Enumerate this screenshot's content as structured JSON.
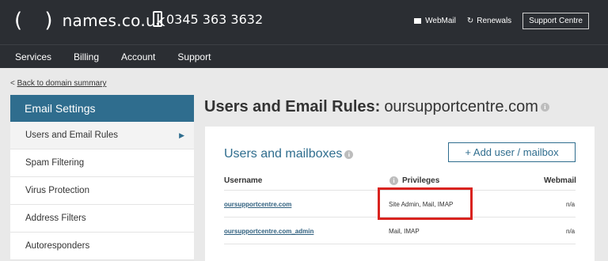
{
  "header": {
    "logo_brackets": "( )",
    "logo_text": "names.co.uk",
    "phone": "0345 363 3632",
    "webmail": "WebMail",
    "renewals": "Renewals",
    "support_centre": "Support Centre"
  },
  "nav": [
    "Services",
    "Billing",
    "Account",
    "Support"
  ],
  "breadcrumb": {
    "prefix": "<",
    "back_link": "Back to domain summary"
  },
  "sidebar": {
    "heading": "Email Settings",
    "items": [
      {
        "label": "Users and Email Rules",
        "active": true
      },
      {
        "label": "Spam Filtering"
      },
      {
        "label": "Virus Protection"
      },
      {
        "label": "Address Filters"
      },
      {
        "label": "Autoresponders"
      }
    ]
  },
  "page": {
    "title_bold": "Users and Email Rules:",
    "title_domain": "oursupportcentre.com"
  },
  "panel": {
    "title": "Users and mailboxes",
    "add_button": "+ Add user / mailbox",
    "columns": {
      "username": "Username",
      "privileges": "Privileges",
      "webmail": "Webmail"
    },
    "rows": [
      {
        "username": "oursupportcentre.com",
        "privileges": "Site Admin, Mail, IMAP",
        "webmail": "n/a"
      },
      {
        "username": "oursupportcentre.com_admin",
        "privileges": "Mail, IMAP",
        "webmail": "n/a"
      }
    ]
  },
  "colors": {
    "header_bg": "#2b2e33",
    "accent": "#2f6d8e",
    "highlight": "#d9231f"
  }
}
